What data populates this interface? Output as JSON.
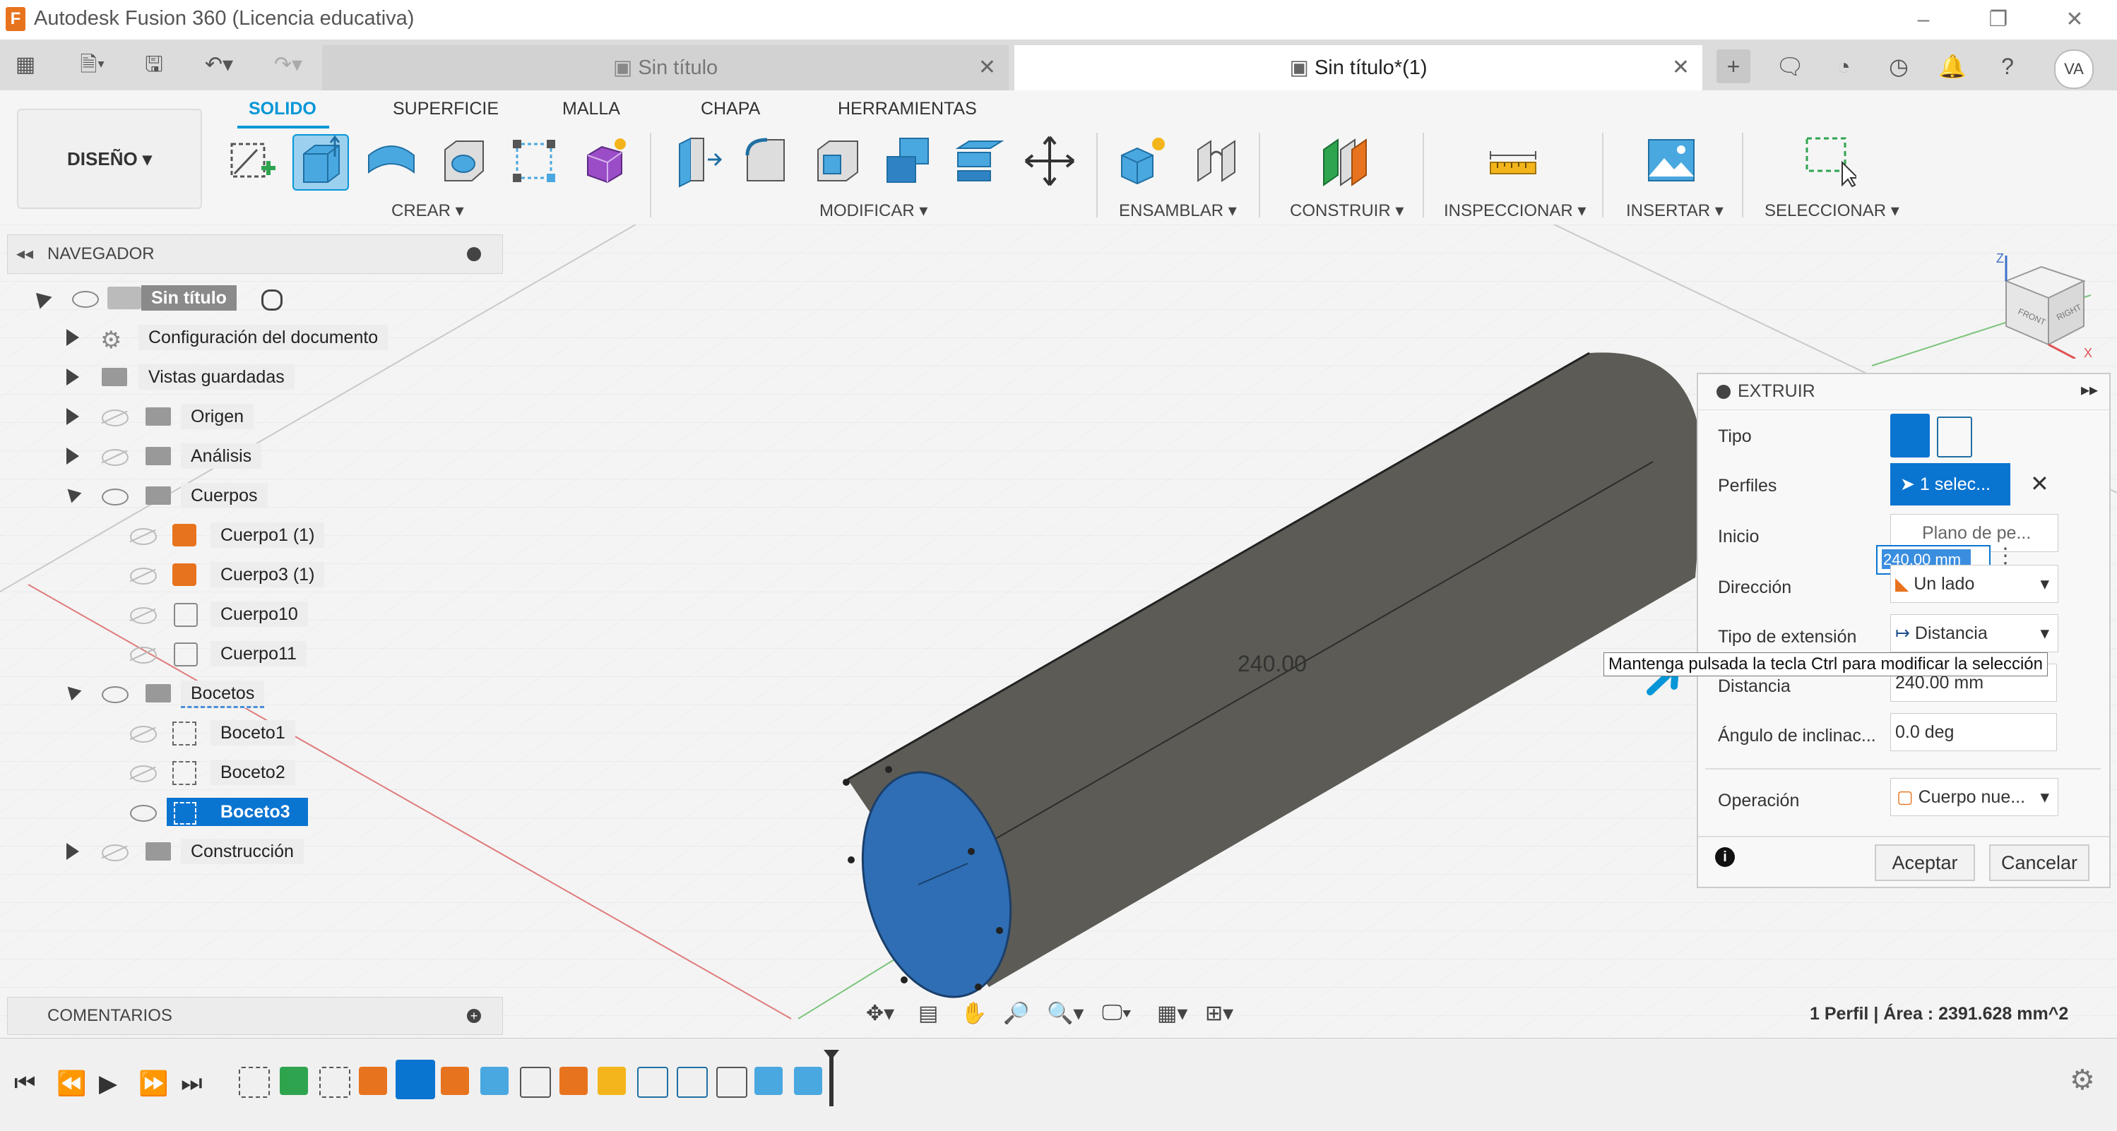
{
  "app": {
    "title": "Autodesk Fusion 360 (Licencia educativa)",
    "logo_letter": "F"
  },
  "tabs": [
    {
      "label": "Sin título",
      "active": false
    },
    {
      "label": "Sin título*(1)",
      "active": true
    }
  ],
  "user": {
    "initials": "VA"
  },
  "ribbon": {
    "workspace": "DISEÑO ▾",
    "tabs": [
      "SOLIDO",
      "SUPERFICIE",
      "MALLA",
      "CHAPA",
      "HERRAMIENTAS"
    ],
    "active_tab": "SOLIDO",
    "groups": [
      "CREAR ▾",
      "MODIFICAR ▾",
      "ENSAMBLAR ▾",
      "CONSTRUIR ▾",
      "INSPECCIONAR ▾",
      "INSERTAR ▾",
      "SELECCIONAR ▾"
    ]
  },
  "navigator": {
    "header": "NAVEGADOR",
    "root": "Sin título",
    "items": [
      {
        "label": "Configuración del documento"
      },
      {
        "label": "Vistas guardadas"
      },
      {
        "label": "Origen"
      },
      {
        "label": "Análisis"
      },
      {
        "label": "Cuerpos"
      },
      {
        "label": "Cuerpo1 (1)"
      },
      {
        "label": "Cuerpo3 (1)"
      },
      {
        "label": "Cuerpo10"
      },
      {
        "label": "Cuerpo11"
      },
      {
        "label": "Bocetos"
      },
      {
        "label": "Boceto1"
      },
      {
        "label": "Boceto2"
      },
      {
        "label": "Boceto3"
      },
      {
        "label": "Construcción"
      }
    ]
  },
  "comments": {
    "label": "COMENTARIOS"
  },
  "viewport": {
    "dimension_label": "240.00",
    "status": "1 Perfil | Área : 2391.628 mm^2",
    "cube_faces": [
      "FRONT",
      "RIGHT"
    ],
    "axes": [
      "Z",
      "X"
    ],
    "colors": {
      "body": "#5c5b55",
      "profile": "#2f6eb5",
      "accent": "#0696d7"
    }
  },
  "extrude_panel": {
    "title": "EXTRUIR",
    "tipo": "Tipo",
    "perfiles": "Perfiles",
    "perfiles_value": "1 selec...",
    "inicio": "Inicio",
    "inicio_value": "Plano de pe...",
    "input_value": "240.00 mm",
    "direccion": "Dirección",
    "direccion_value": "Un lado",
    "tipo_extension": "Tipo de extensión",
    "tipo_extension_value": "Distancia",
    "distancia": "Distancia",
    "distancia_value": "240.00 mm",
    "angulo": "Ángulo de inclinac...",
    "angulo_value": "0.0 deg",
    "operacion": "Operación",
    "operacion_value": "Cuerpo nue...",
    "aceptar": "Aceptar",
    "cancelar": "Cancelar"
  },
  "tooltip": "Mantenga pulsada la tecla Ctrl para modificar la selección"
}
